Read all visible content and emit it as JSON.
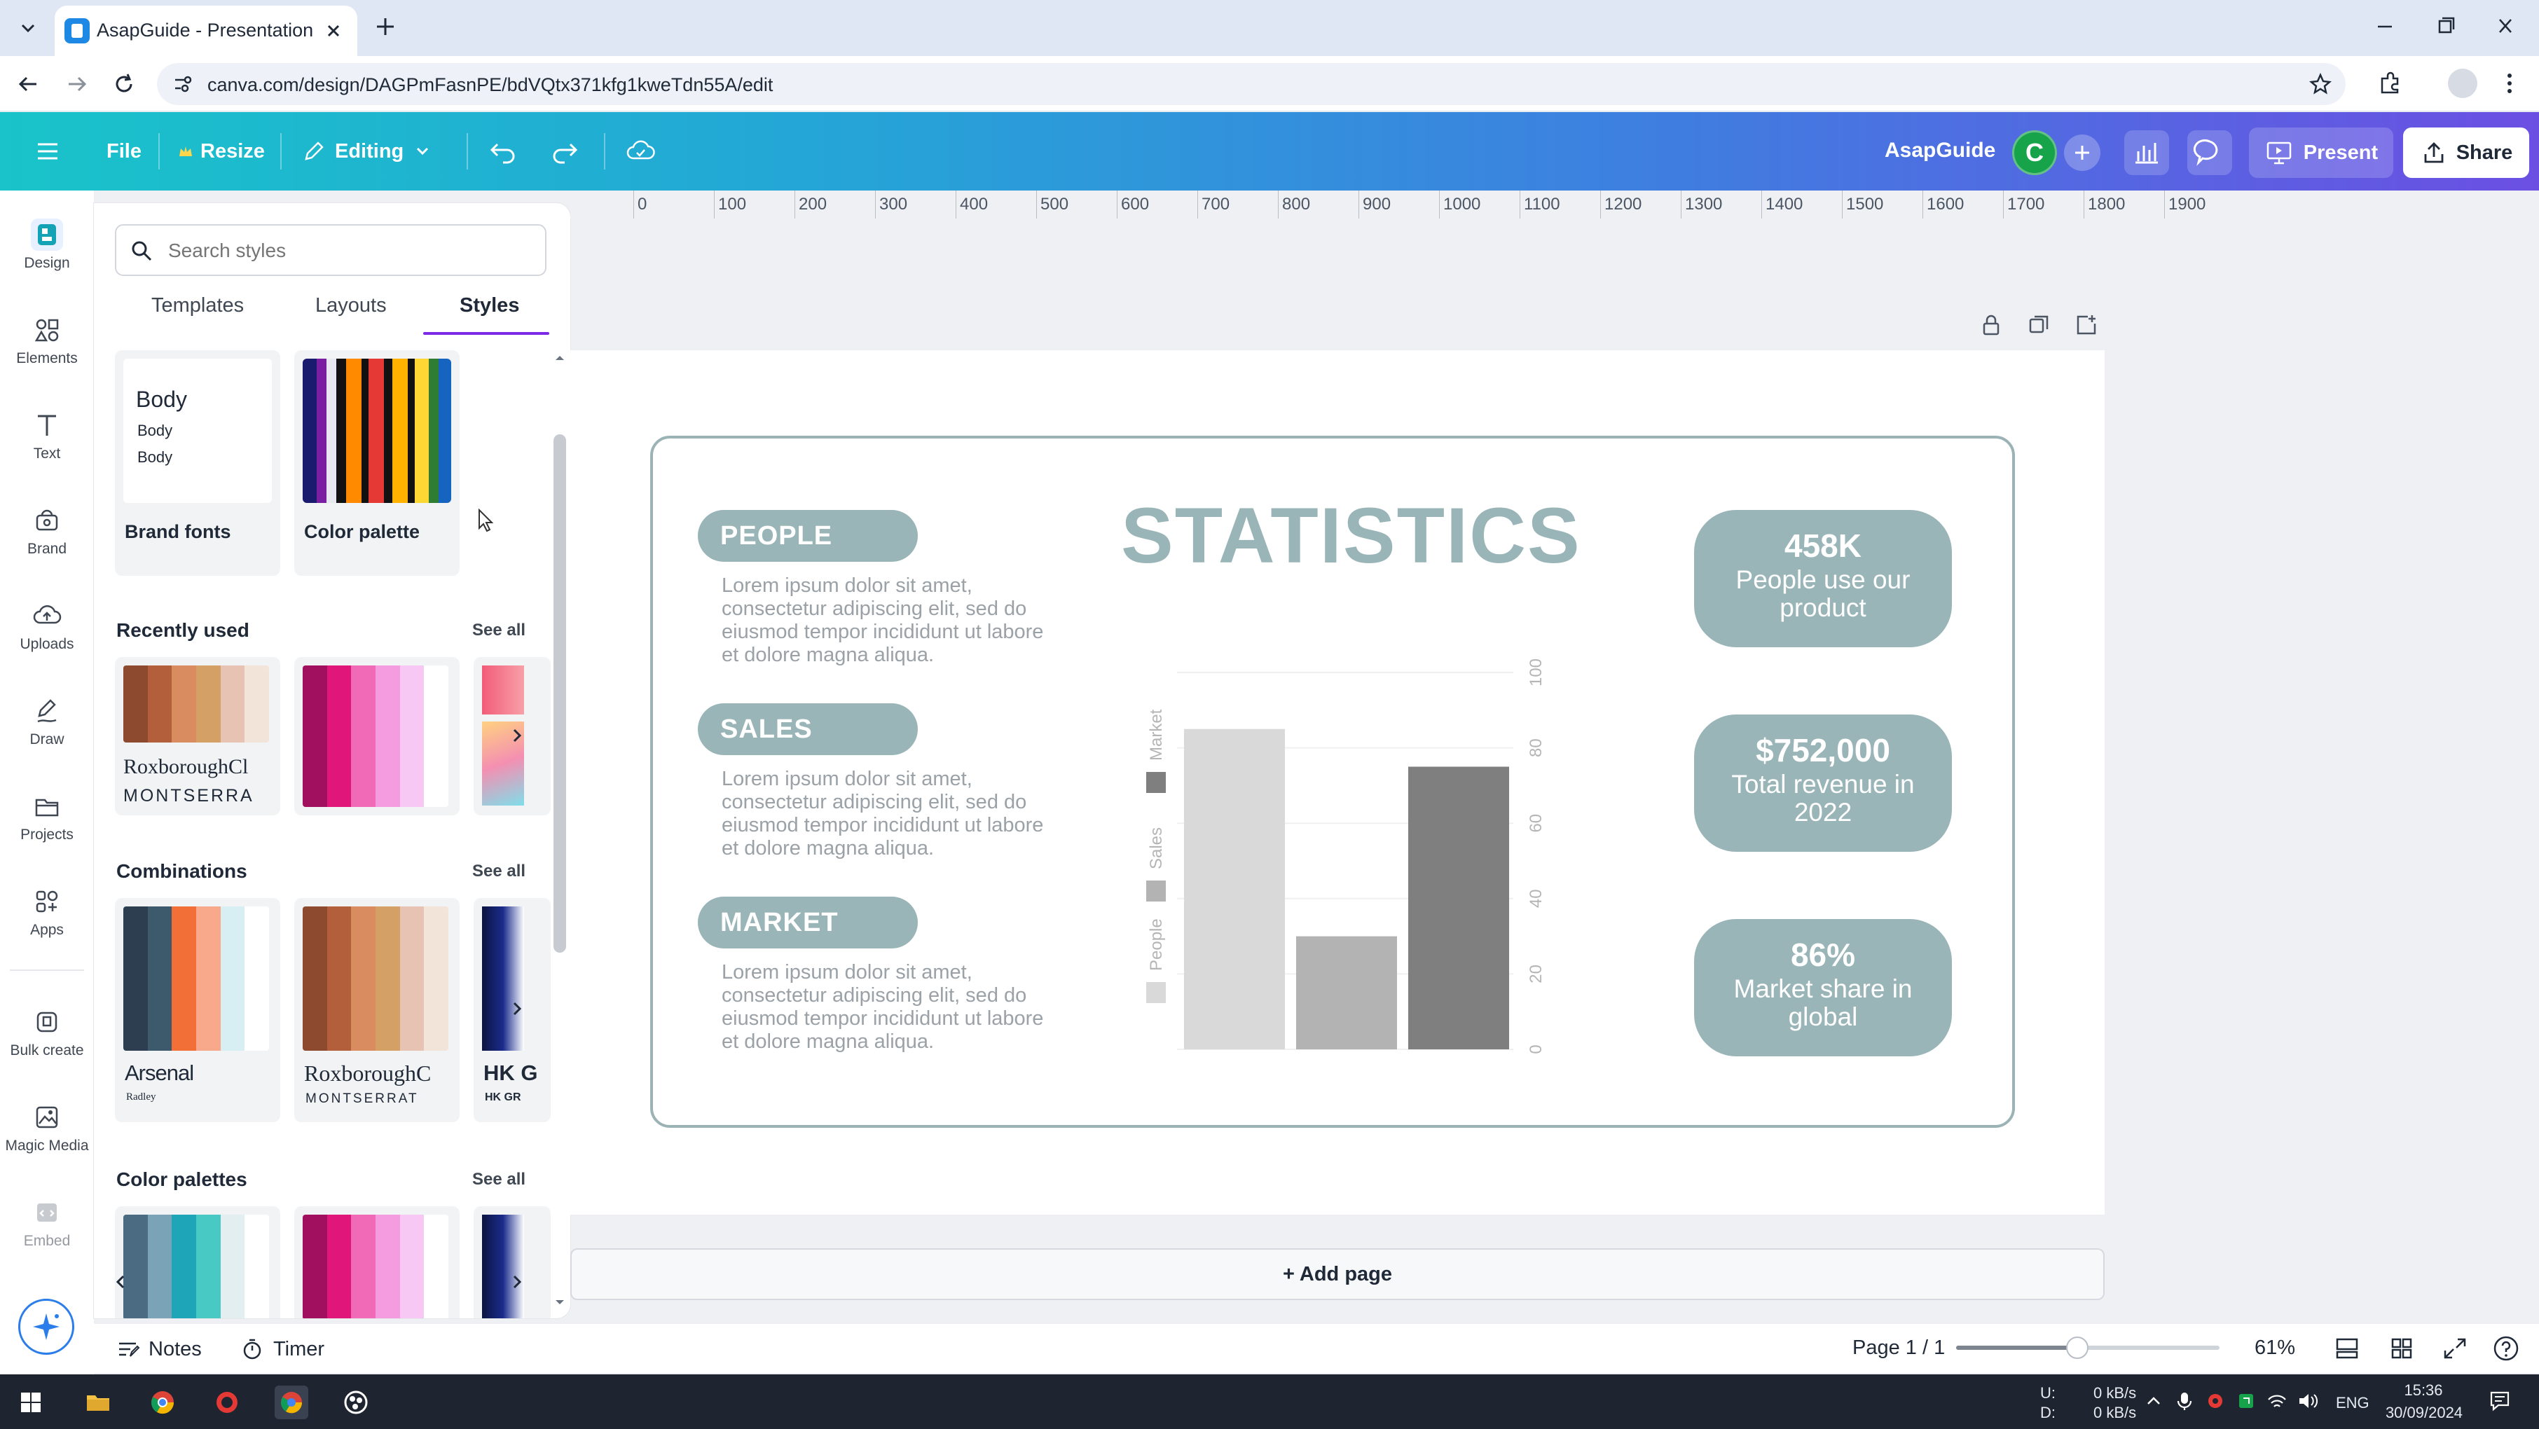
{
  "browser": {
    "tab_title": "AsapGuide - Presentation",
    "url": "canva.com/design/DAGPmFasnPE/bdVQtx371kfg1kweTdn55A/edit"
  },
  "header": {
    "file": "File",
    "resize": "Resize",
    "editing": "Editing",
    "brand_name": "AsapGuide",
    "avatar_initial": "C",
    "present": "Present",
    "share": "Share",
    "gradient_colors": [
      "#19c3c9",
      "#3e7fe0",
      "#6b4fe3"
    ]
  },
  "rail": {
    "items": [
      {
        "label": "Design",
        "icon": "design-icon"
      },
      {
        "label": "Elements",
        "icon": "elements-icon"
      },
      {
        "label": "Text",
        "icon": "text-icon"
      },
      {
        "label": "Brand",
        "icon": "brand-icon"
      },
      {
        "label": "Uploads",
        "icon": "uploads-icon"
      },
      {
        "label": "Draw",
        "icon": "draw-icon"
      },
      {
        "label": "Projects",
        "icon": "projects-icon"
      },
      {
        "label": "Apps",
        "icon": "apps-icon"
      },
      {
        "label": "Bulk create",
        "icon": "bulk-create-icon"
      },
      {
        "label": "Magic Media",
        "icon": "magic-media-icon"
      },
      {
        "label": "Embed",
        "icon": "embed-icon"
      }
    ]
  },
  "panel": {
    "search_placeholder": "Search styles",
    "tabs": [
      "Templates",
      "Layouts",
      "Styles"
    ],
    "active_tab": "Styles",
    "brand_fonts": {
      "title": "Body",
      "lines": [
        "Body",
        "Body"
      ],
      "label": "Brand fonts"
    },
    "color_palette_label": "Color palette",
    "recently_used_title": "Recently used",
    "combinations_title": "Combinations",
    "color_palettes_title": "Color palettes",
    "see_all": "See all",
    "recent_font_main": "RoxboroughCl",
    "recent_font_sub": "MONTSERRA",
    "combo_1_main": "Arsenal",
    "combo_1_sub": "Radley",
    "combo_2_main": "RoxboroughC",
    "combo_2_sub": "MONTSERRAT",
    "combo_3_main": "HK G",
    "combo_3_sub": "HK GR"
  },
  "ruler": [
    "0",
    "100",
    "200",
    "300",
    "400",
    "500",
    "600",
    "700",
    "800",
    "900",
    "1000",
    "1100",
    "1200",
    "1300",
    "1400",
    "1500",
    "1600",
    "1700",
    "1800",
    "1900"
  ],
  "slide": {
    "title": "STATISTICS",
    "sections": [
      {
        "label": "PEOPLE",
        "text": [
          "Lorem ipsum dolor sit amet,",
          "consectetur adipiscing elit, sed do",
          "eiusmod tempor incididunt ut labore",
          "et dolore magna aliqua."
        ]
      },
      {
        "label": "SALES",
        "text": [
          "Lorem ipsum dolor sit amet,",
          "consectetur adipiscing elit, sed do",
          "eiusmod tempor incididunt ut labore",
          "et dolore magna aliqua."
        ]
      },
      {
        "label": "MARKET",
        "text": [
          "Lorem ipsum dolor sit amet,",
          "consectetur adipiscing elit, sed do",
          "eiusmod tempor incididunt ut labore",
          "et dolore magna aliqua."
        ]
      }
    ],
    "stats": [
      {
        "value": "458K",
        "desc": "People use our product"
      },
      {
        "value": "$752,000",
        "desc": "Total revenue in 2022"
      },
      {
        "value": "86%",
        "desc": "Market share in global"
      }
    ],
    "accent_color": "#9ab5b8"
  },
  "chart_data": {
    "type": "bar",
    "categories": [
      "People",
      "Sales",
      "Market"
    ],
    "series": [
      {
        "name": "People",
        "values": [
          85
        ],
        "color": "#d9d9d9"
      },
      {
        "name": "Sales",
        "values": [
          30
        ],
        "color": "#b3b3b3"
      },
      {
        "name": "Market",
        "values": [
          75
        ],
        "color": "#7f7f7f"
      }
    ],
    "ylim": [
      0,
      100
    ],
    "yticks": [
      "0",
      "20",
      "40",
      "60",
      "80",
      "100"
    ],
    "legend": [
      "People",
      "Sales",
      "Market"
    ],
    "orientation": "rotated",
    "grid": true
  },
  "add_page": "+ Add page",
  "bottom": {
    "notes": "Notes",
    "timer": "Timer",
    "page": "Page 1 / 1",
    "zoom": "61%",
    "zoom_fraction": 0.46
  },
  "taskbar": {
    "net_up_label": "U:",
    "net_down_label": "D:",
    "net_up": "0 kB/s",
    "net_down": "0 kB/s",
    "lang": "ENG",
    "time": "15:36",
    "date": "30/09/2024"
  }
}
